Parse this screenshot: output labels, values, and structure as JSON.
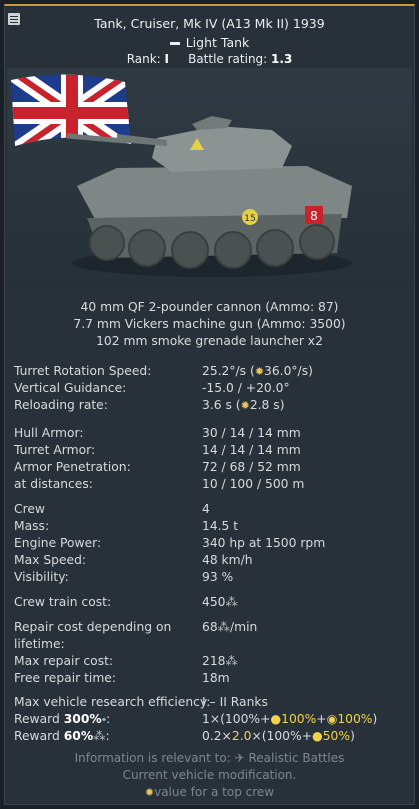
{
  "header": {
    "title": "Tank, Cruiser, Mk IV (A13 Mk II) 1939",
    "type": "Light Tank",
    "rank_label": "Rank:",
    "rank_value": "I",
    "br_label": "Battle rating:",
    "br_value": "1.3"
  },
  "weapons": [
    "40 mm QF 2-pounder cannon (Ammo: 87)",
    "7.7 mm Vickers machine gun (Ammo: 3500)",
    "102 mm smoke grenade launcher x2"
  ],
  "stats": {
    "turret_rotation": {
      "label": "Turret Rotation Speed:",
      "value": "25.2°/s",
      "open": "(",
      "bonus": "36.0°/s",
      "close": ")"
    },
    "vertical_guidance": {
      "label": "Vertical Guidance:",
      "value": "-15.0 / +20.0°"
    },
    "reloading": {
      "label": "Reloading rate:",
      "value": "3.6 s",
      "open": "(",
      "bonus": "2.8 s",
      "close": ")"
    },
    "hull_armor": {
      "label": "Hull Armor:",
      "value": "30 / 14 / 14 mm"
    },
    "turret_armor": {
      "label": "Turret Armor:",
      "value": "14 / 14 / 14 mm"
    },
    "armor_pen": {
      "label": "Armor Penetration:",
      "value": "72 / 68 / 52 mm"
    },
    "distances": {
      "label": "at distances:",
      "value": "10 / 100 / 500 m"
    },
    "crew": {
      "label": "Crew",
      "value": "4"
    },
    "mass": {
      "label": "Mass:",
      "value": "14.5 t"
    },
    "engine": {
      "label": "Engine Power:",
      "value": "340 hp at 1500 rpm"
    },
    "max_speed": {
      "label": "Max Speed:",
      "value": "48 km/h"
    },
    "visibility": {
      "label": "Visibility:",
      "value": "93 %"
    },
    "crew_train": {
      "label": "Crew train cost:",
      "value": "450"
    },
    "repair_cost": {
      "label": "Repair cost depending on lifetime:",
      "value": "68",
      "suffix": "/min"
    },
    "max_repair": {
      "label": "Max repair cost:",
      "value": "218"
    },
    "free_repair": {
      "label": "Free repair time:",
      "value": "18m"
    },
    "research_eff": {
      "label": "Max vehicle research efficiency:",
      "value": "I – II Ranks"
    },
    "reward_rp": {
      "label_prefix": "Reward ",
      "label_pct": "300%",
      "label_colon": ":",
      "v1": "1×(100%+",
      "v2": "100%",
      "v3": "+",
      "v4": "100%",
      "v5": ")"
    },
    "reward_sl": {
      "label_prefix": "Reward ",
      "label_pct": "60%",
      "label_colon": ":",
      "v1": "0.2×",
      "v2": "2.0",
      "v3": "×(100%+",
      "v4": "50%",
      "v5": ")"
    }
  },
  "footer": {
    "line1_prefix": "Information is relevant to:",
    "line1_mode": "Realistic Battles",
    "line2": "Current vehicle modification.",
    "line3": "value for a top crew"
  },
  "colors": {
    "accent": "#c79a3b",
    "gold": "#f0d24a",
    "panel": "#283139"
  }
}
